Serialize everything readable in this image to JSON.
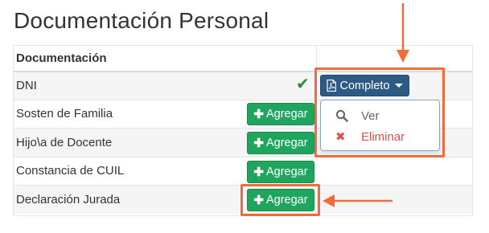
{
  "page": {
    "title": "Documentación Personal"
  },
  "table": {
    "header": "Documentación",
    "rows": [
      {
        "name": "DNI",
        "status": "complete"
      },
      {
        "name": "Sosten de Familia",
        "action": "Agregar"
      },
      {
        "name": "Hijo\\a de Docente",
        "action": "Agregar"
      },
      {
        "name": "Constancia de CUIL",
        "action": "Agregar"
      },
      {
        "name": "Declaración Jurada",
        "action": "Agregar"
      }
    ]
  },
  "complete_button": {
    "label": "Completo",
    "icon": "file-pdf-icon"
  },
  "dropdown": {
    "items": [
      {
        "label": "Ver",
        "icon": "search-icon"
      },
      {
        "label": "Eliminar",
        "icon": "close-icon"
      }
    ]
  },
  "colors": {
    "add_button": "#1fa55e",
    "complete_button": "#2c5a85",
    "highlight": "#f26b3a",
    "check": "#2e8b2e",
    "danger": "#d9534f"
  }
}
